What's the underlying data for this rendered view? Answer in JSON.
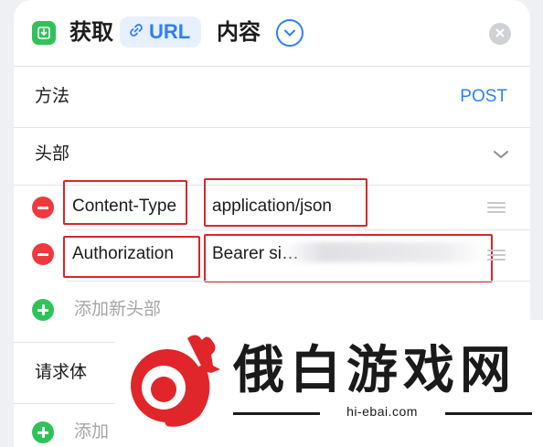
{
  "header": {
    "title_pre": "获取",
    "url_token": "URL",
    "title_post": "内容",
    "app_icon": "download-box-icon",
    "url_icon": "link-icon",
    "expand_icon": "chevron-down-circle-icon",
    "close_icon": "close-icon"
  },
  "method": {
    "label": "方法",
    "value": "POST"
  },
  "headers_section": {
    "label": "头部",
    "toggle_icon": "chevron-down-icon"
  },
  "header_rows": [
    {
      "key": "Content-Type",
      "value": "application/json"
    },
    {
      "key": "Authorization",
      "value": "Bearer si…"
    }
  ],
  "add_header": {
    "label": "添加新头部"
  },
  "body_section": {
    "label": "请求体"
  },
  "add_body": {
    "label": "添加"
  },
  "watermark": {
    "brand": "俄白游戏网",
    "url": "hi-ebai.com"
  },
  "colors": {
    "accent": "#2f7ff5",
    "danger": "#ee3a3f",
    "success": "#30c25a",
    "highlight": "#d8262b"
  }
}
